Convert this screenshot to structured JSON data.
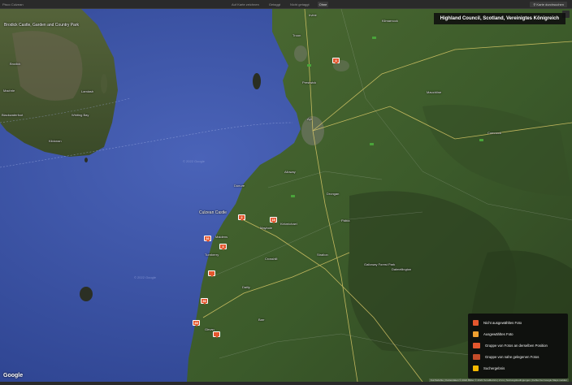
{
  "topbar": {
    "breadcrumb": "Pisco Culzean",
    "filters": [
      "Auf Karte zeichnen",
      "Getaggt",
      "Nicht getaggt",
      "Ohne"
    ],
    "active_filter_index": 3,
    "search_button": "Karte durchsuchen"
  },
  "map": {
    "region_title": "Highland Council, Scotland, Vereinigtes Königreich",
    "pois": [
      {
        "name": "Brodick Castle, Garden and Country Park"
      },
      {
        "name": "Culzean Castle"
      }
    ],
    "places": [
      "Brodick",
      "Lamlash",
      "Whiting Bay",
      "Kildonan",
      "Blackwaterfoot",
      "Machrie",
      "Prestwick",
      "Ayr",
      "Troon",
      "Irvine",
      "Kilmarnock",
      "Mauchline",
      "Cumnock",
      "Maybole",
      "Girvan",
      "Turnberry",
      "Maidens",
      "Dunure",
      "Alloway",
      "Dalmellington",
      "Patna",
      "Drongan",
      "Straiton",
      "Crosshill",
      "Dailly",
      "Kirkmichael",
      "Galloway Forest Park",
      "Barr"
    ],
    "markers": [
      {
        "label": "4",
        "color": "#e4572e"
      },
      {
        "label": "2",
        "color": "#e4572e"
      },
      {
        "label": "18",
        "color": "#e4572e"
      },
      {
        "label": "36",
        "color": "#e4572e"
      },
      {
        "label": "4",
        "color": "#e4572e"
      },
      {
        "label": "",
        "color": "#e4572e"
      },
      {
        "label": "36",
        "color": "#e4572e"
      },
      {
        "label": "48",
        "color": "#e4572e"
      },
      {
        "label": "",
        "color": "#e4572e"
      }
    ]
  },
  "legend": {
    "items": [
      {
        "label": "Nicht ausgewähltes Foto",
        "color": "#e4572e",
        "icon": "single-photo-icon"
      },
      {
        "label": "Ausgewähltes Foto",
        "color": "#f0a030",
        "icon": "selected-photo-icon"
      },
      {
        "label": "Gruppe von Fotos an derselben Position",
        "color": "#e4572e",
        "icon": "photo-group-icon"
      },
      {
        "label": "Gruppe von nahe gelegenen Fotos",
        "color": "#e4572e",
        "icon": "nearby-group-icon"
      },
      {
        "label": "Suchergebnis",
        "color": "#f5b800",
        "icon": "search-result-icon"
      }
    ]
  },
  "footer": {
    "logo": "Google",
    "attribution": "Kurzbefehle | Kartendaten © 2022 Bilder © 2022 TerraMetrics | 2 km | Nutzungsbedingungen | Fehler bei Google Maps melden"
  },
  "colors": {
    "sea": "#3e55a8",
    "land": "#3f5a2c",
    "accent": "#e4572e"
  }
}
